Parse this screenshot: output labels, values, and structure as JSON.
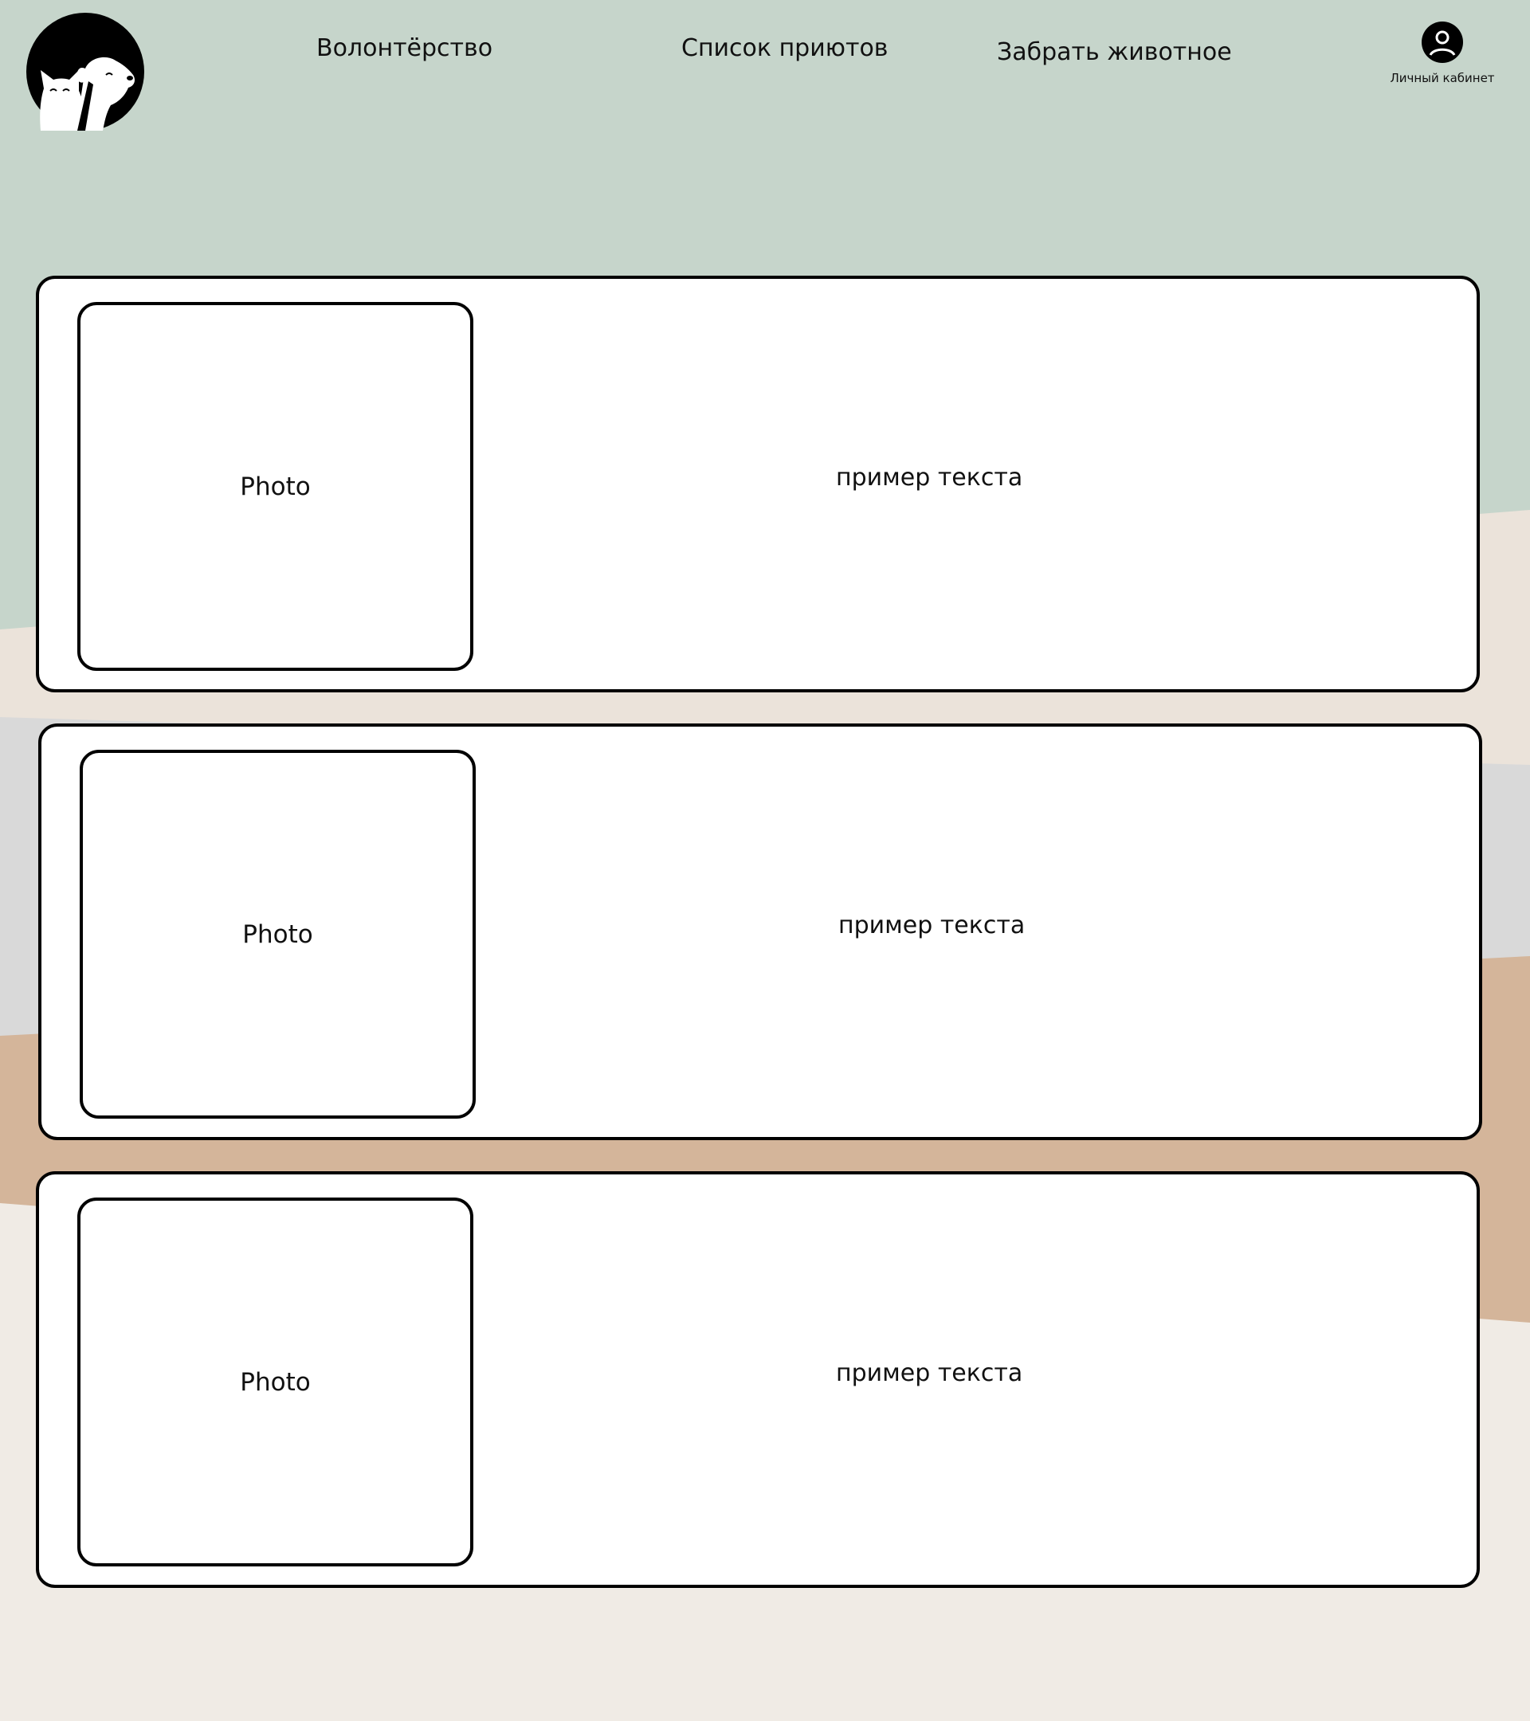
{
  "colors": {
    "header_bg": "#c6d5cb",
    "band_beige": "#ebe3da",
    "band_gray": "#d9d9d9",
    "band_tan": "#d4b59a",
    "bottom_bg": "#f0ebe5",
    "card_bg": "#ffffff",
    "border": "#000000",
    "text": "#111111"
  },
  "header": {
    "logo_icon": "cat-dog-logo-icon",
    "nav": [
      {
        "label": "Волонтёрство"
      },
      {
        "label": "Список приютов"
      },
      {
        "label": "Забрать животное"
      }
    ],
    "profile": {
      "icon": "user-icon",
      "label": "Личный кабинет"
    }
  },
  "cards": [
    {
      "photo_label": "Photo",
      "text": "пример текста"
    },
    {
      "photo_label": "Photo",
      "text": "пример текста"
    },
    {
      "photo_label": "Photo",
      "text": "пример текста"
    }
  ]
}
